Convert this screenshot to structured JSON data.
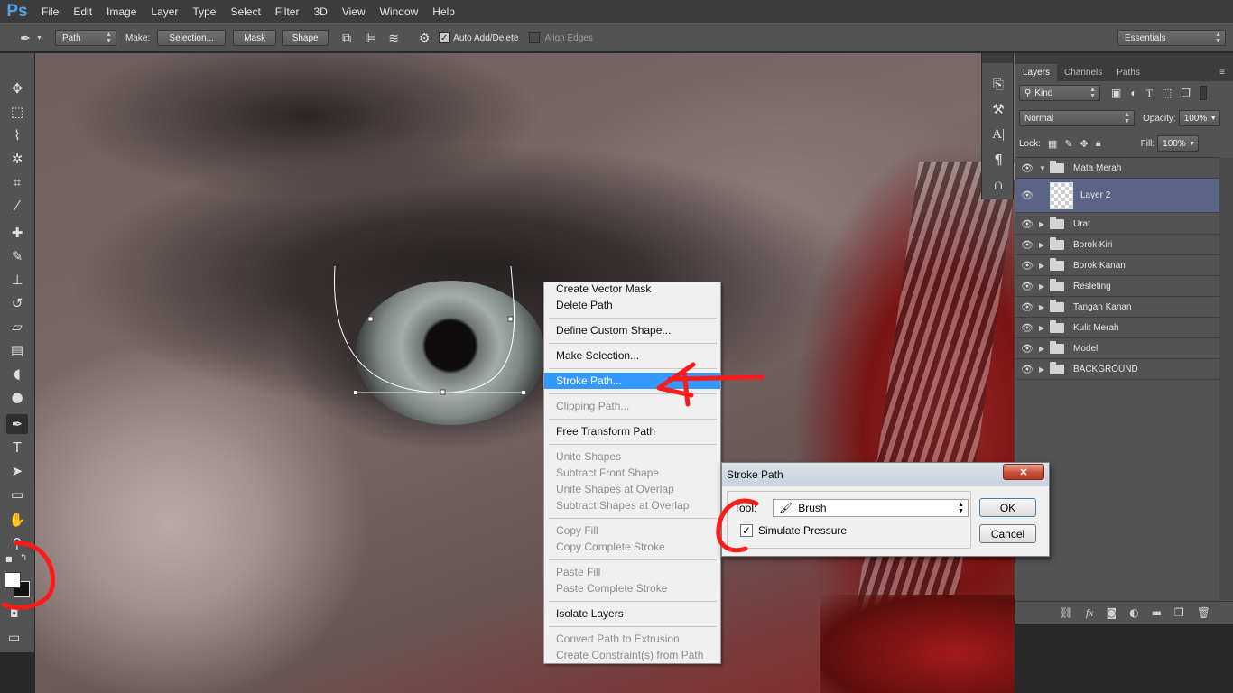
{
  "app": {
    "logo": "Ps"
  },
  "menubar": {
    "items": [
      "File",
      "Edit",
      "Image",
      "Layer",
      "Type",
      "Select",
      "Filter",
      "3D",
      "View",
      "Window",
      "Help"
    ]
  },
  "options": {
    "tool_mode": "Path",
    "make_label": "Make:",
    "selection_btn": "Selection...",
    "mask_btn": "Mask",
    "shape_btn": "Shape",
    "auto_add_delete": "Auto Add/Delete",
    "auto_add_delete_checked": true,
    "align_edges": "Align Edges",
    "align_edges_checked": false,
    "workspace": "Essentials"
  },
  "layers_panel": {
    "tabs": [
      "Layers",
      "Channels",
      "Paths"
    ],
    "active_tab": "Layers",
    "filter_kind": "Kind",
    "blend_mode": "Normal",
    "opacity_label": "Opacity:",
    "opacity": "100%",
    "lock_label": "Lock:",
    "fill_label": "Fill:",
    "fill": "100%",
    "layers": [
      {
        "name": "Mata Merah",
        "type": "group",
        "expanded": true
      },
      {
        "name": "Layer 2",
        "type": "layer",
        "selected": true
      },
      {
        "name": "Urat",
        "type": "group"
      },
      {
        "name": "Borok Kiri",
        "type": "group"
      },
      {
        "name": "Borok Kanan",
        "type": "group"
      },
      {
        "name": "Resleting",
        "type": "group"
      },
      {
        "name": "Tangan Kanan",
        "type": "group"
      },
      {
        "name": "Kulit Merah",
        "type": "group"
      },
      {
        "name": "Model",
        "type": "group"
      },
      {
        "name": "BACKGROUND",
        "type": "group"
      }
    ]
  },
  "context_menu": {
    "items": [
      {
        "label": "Create Vector Mask",
        "enabled": true
      },
      {
        "label": "Delete Path",
        "enabled": true
      },
      {
        "label": "Define Custom Shape...",
        "enabled": true
      },
      {
        "label": "Make Selection...",
        "enabled": true
      },
      {
        "label": "Stroke Path...",
        "enabled": true,
        "highlighted": true
      },
      {
        "label": "Clipping Path...",
        "enabled": false
      },
      {
        "label": "Free Transform Path",
        "enabled": true
      },
      {
        "label": "Unite Shapes",
        "enabled": false
      },
      {
        "label": "Subtract Front Shape",
        "enabled": false
      },
      {
        "label": "Unite Shapes at Overlap",
        "enabled": false
      },
      {
        "label": "Subtract Shapes at Overlap",
        "enabled": false
      },
      {
        "label": "Copy Fill",
        "enabled": false
      },
      {
        "label": "Copy Complete Stroke",
        "enabled": false
      },
      {
        "label": "Paste Fill",
        "enabled": false
      },
      {
        "label": "Paste Complete Stroke",
        "enabled": false
      },
      {
        "label": "Isolate Layers",
        "enabled": true
      },
      {
        "label": "Convert Path to Extrusion",
        "enabled": false
      },
      {
        "label": "Create Constraint(s) from Path",
        "enabled": false
      }
    ]
  },
  "dialog": {
    "title": "Stroke Path",
    "close": "✕",
    "tool_label": "Tool:",
    "tool_value": "Brush",
    "simulate_pressure": "Simulate Pressure",
    "simulate_pressure_checked": true,
    "ok": "OK",
    "cancel": "Cancel"
  },
  "colors": {
    "highlight": "#3399ff",
    "annotation": "#ff1a1a",
    "selected_layer": "#5b6386"
  }
}
